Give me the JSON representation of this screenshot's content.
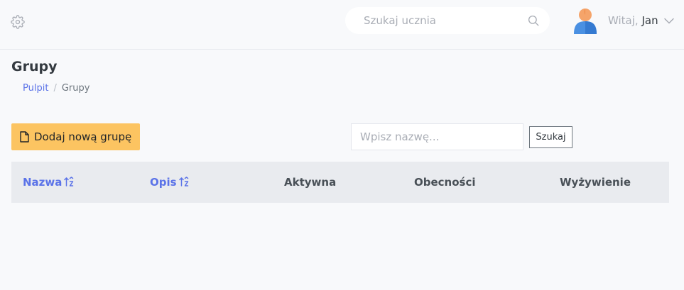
{
  "header": {
    "search_placeholder": "Szukaj ucznia",
    "greeting": "Witaj,",
    "user_name": "Jan",
    "avatar_colors": {
      "head": "#f5a46a",
      "body": "#4a90e2"
    }
  },
  "page": {
    "title": "Grupy",
    "breadcrumb": [
      {
        "label": "Pulpit"
      },
      {
        "label": "Grupy"
      }
    ]
  },
  "toolbar": {
    "add_button_label": "Dodaj nową grupę",
    "name_filter_placeholder": "Wpisz nazwę...",
    "search_button_label": "Szukaj"
  },
  "table": {
    "columns": [
      {
        "label": "Nazwa",
        "sortable": true
      },
      {
        "label": "Opis",
        "sortable": true
      },
      {
        "label": "Aktywna",
        "sortable": false
      },
      {
        "label": "Obecności",
        "sortable": false
      },
      {
        "label": "Wyżywienie",
        "sortable": false
      }
    ],
    "rows": []
  },
  "colors": {
    "accent": "#5b73e8",
    "add_button": "#fcc461",
    "table_header_bg": "#e9ebef",
    "page_bg": "#f8f9fb"
  },
  "icons": [
    "gear-icon",
    "search-icon",
    "chevron-down-icon",
    "file-icon",
    "sort-icon"
  ]
}
